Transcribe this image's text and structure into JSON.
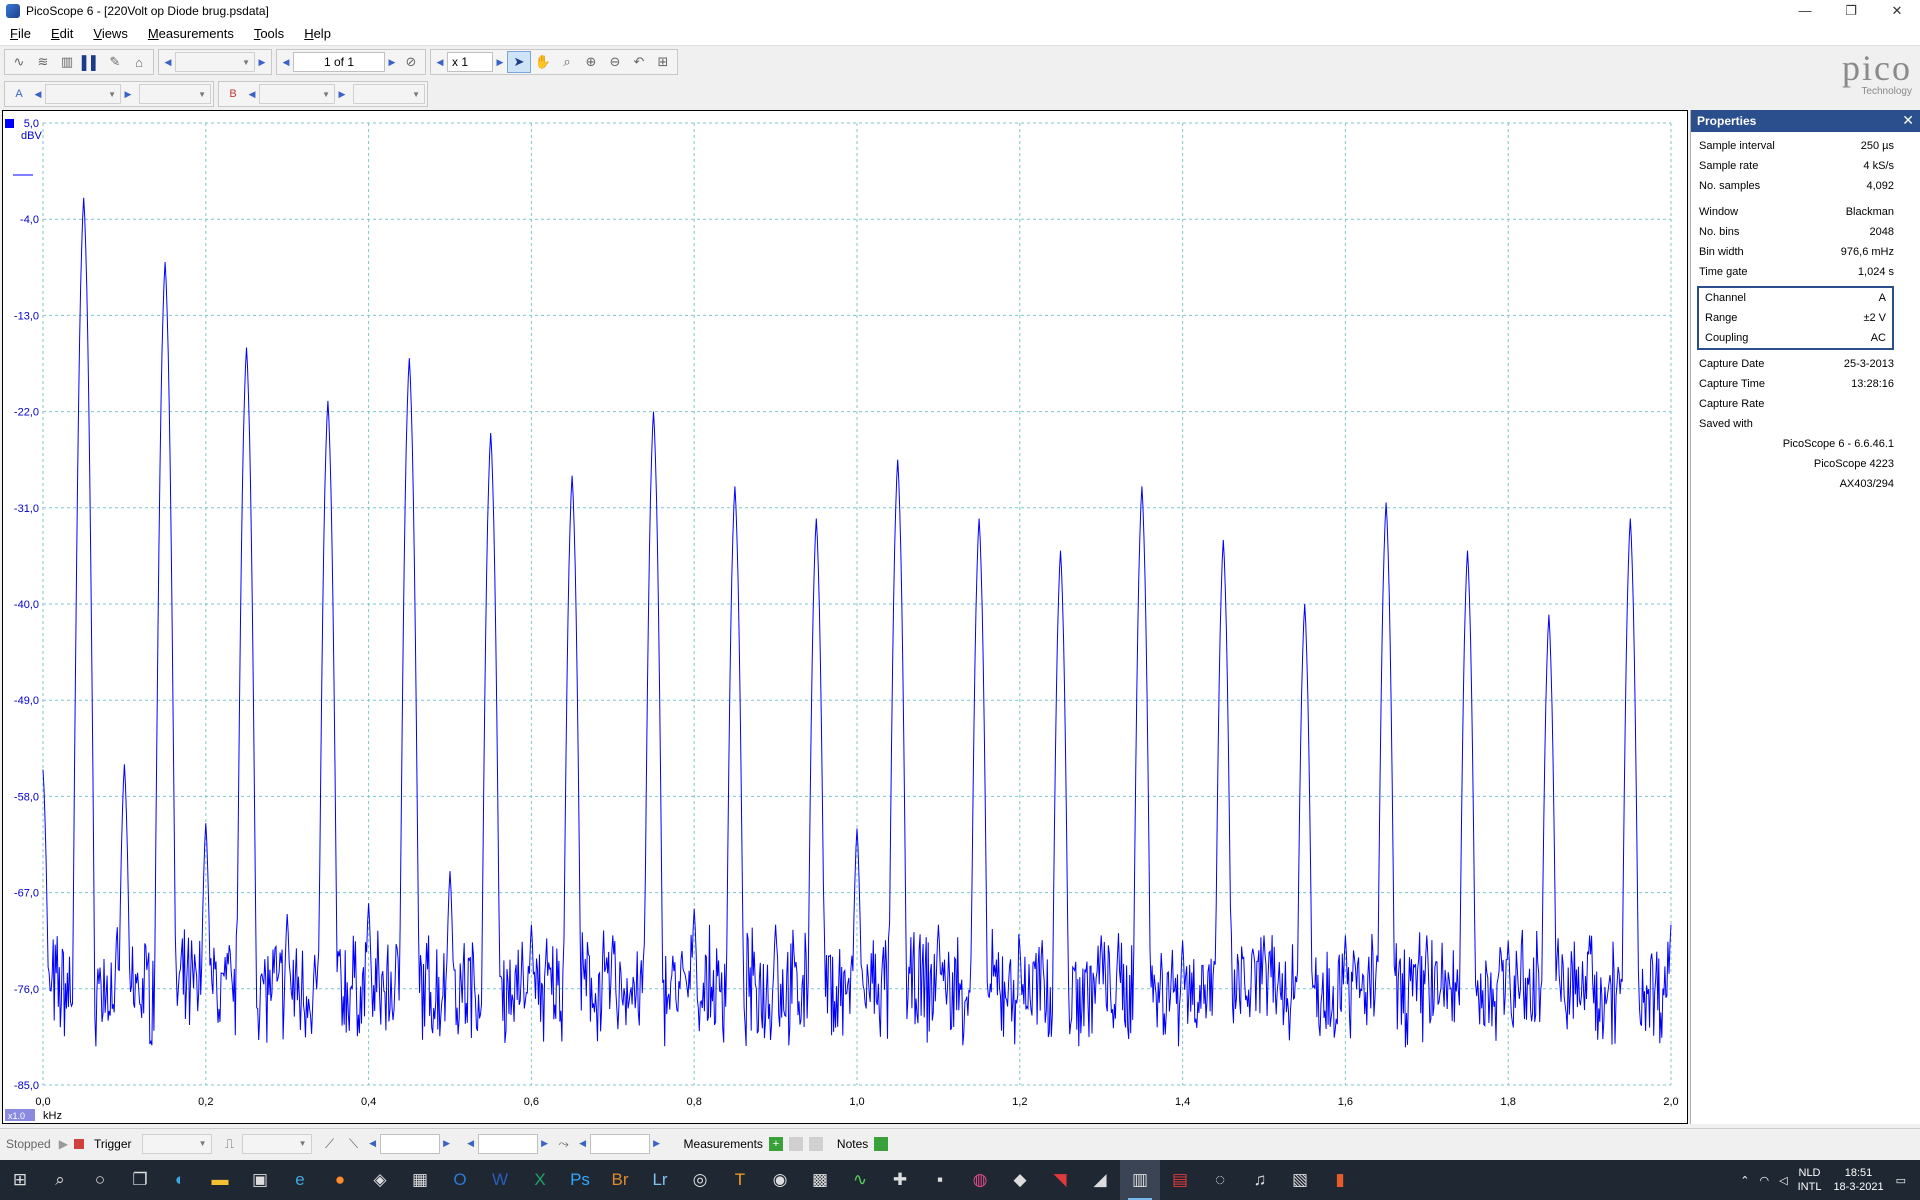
{
  "window": {
    "title": "PicoScope 6 - [220Volt op Diode brug.psdata]",
    "controls": [
      "—",
      "❐",
      "✕"
    ]
  },
  "menu": [
    "File",
    "Edit",
    "Views",
    "Measurements",
    "Tools",
    "Help"
  ],
  "toolbar": {
    "page_indicator": "1 of 1",
    "zoom_factor": "x 1"
  },
  "channels": {
    "a_label": "A",
    "b_label": "B"
  },
  "logo": {
    "brand": "pico",
    "sub": "Technology"
  },
  "plot": {
    "y_unit": "dBV",
    "x_unit": "kHz",
    "x_scale_badge": "x1.0",
    "accent": "#0000ff"
  },
  "chart_data": {
    "type": "line",
    "x_unit": "kHz",
    "y_unit": "dBV",
    "xlim": [
      0.0,
      2.0
    ],
    "ylim": [
      -85.0,
      5.0
    ],
    "x_ticks": [
      "0,0",
      "0,2",
      "0,4",
      "0,6",
      "0,8",
      "1,0",
      "1,2",
      "1,4",
      "1,6",
      "1,8",
      "2,0"
    ],
    "y_ticks": [
      "5,0",
      "-4,0",
      "-13,0",
      "-22,0",
      "-31,0",
      "-40,0",
      "-49,0",
      "-58,0",
      "-67,0",
      "-76,0",
      "-85,0"
    ],
    "grid": true,
    "noise_floor": -76.0,
    "peaks": [
      {
        "x": 0.0,
        "y": -55.5
      },
      {
        "x": 0.05,
        "y": -2.0
      },
      {
        "x": 0.1,
        "y": -55.0
      },
      {
        "x": 0.15,
        "y": -8.0
      },
      {
        "x": 0.2,
        "y": -60.5
      },
      {
        "x": 0.25,
        "y": -16.0
      },
      {
        "x": 0.3,
        "y": -69.0
      },
      {
        "x": 0.35,
        "y": -21.0
      },
      {
        "x": 0.4,
        "y": -68.0
      },
      {
        "x": 0.45,
        "y": -17.0
      },
      {
        "x": 0.5,
        "y": -65.0
      },
      {
        "x": 0.55,
        "y": -24.0
      },
      {
        "x": 0.6,
        "y": -70.0
      },
      {
        "x": 0.65,
        "y": -28.0
      },
      {
        "x": 0.7,
        "y": -71.0
      },
      {
        "x": 0.75,
        "y": -22.0
      },
      {
        "x": 0.8,
        "y": -68.5
      },
      {
        "x": 0.85,
        "y": -29.0
      },
      {
        "x": 0.9,
        "y": -70.0
      },
      {
        "x": 0.95,
        "y": -32.0
      },
      {
        "x": 1.0,
        "y": -61.0
      },
      {
        "x": 1.05,
        "y": -26.5
      },
      {
        "x": 1.1,
        "y": -70.0
      },
      {
        "x": 1.15,
        "y": -32.0
      },
      {
        "x": 1.2,
        "y": -72.0
      },
      {
        "x": 1.25,
        "y": -35.0
      },
      {
        "x": 1.3,
        "y": -71.0
      },
      {
        "x": 1.35,
        "y": -29.0
      },
      {
        "x": 1.4,
        "y": -71.5
      },
      {
        "x": 1.45,
        "y": -34.0
      },
      {
        "x": 1.5,
        "y": -71.0
      },
      {
        "x": 1.55,
        "y": -40.0
      },
      {
        "x": 1.6,
        "y": -71.0
      },
      {
        "x": 1.65,
        "y": -30.5
      },
      {
        "x": 1.7,
        "y": -71.0
      },
      {
        "x": 1.75,
        "y": -35.0
      },
      {
        "x": 1.8,
        "y": -71.5
      },
      {
        "x": 1.85,
        "y": -41.0
      },
      {
        "x": 1.9,
        "y": -71.0
      },
      {
        "x": 1.95,
        "y": -32.0
      },
      {
        "x": 2.0,
        "y": -70.0
      }
    ]
  },
  "properties": {
    "title": "Properties",
    "rows1": [
      {
        "k": "Sample interval",
        "v": "250 µs"
      },
      {
        "k": "Sample rate",
        "v": "4 kS/s"
      },
      {
        "k": "No. samples",
        "v": "4,092"
      }
    ],
    "rows2": [
      {
        "k": "Window",
        "v": "Blackman"
      },
      {
        "k": "No. bins",
        "v": "2048"
      },
      {
        "k": "Bin width",
        "v": "976,6 mHz"
      },
      {
        "k": "Time gate",
        "v": "1,024 s"
      }
    ],
    "channel_box": [
      {
        "k": "Channel",
        "v": "A"
      },
      {
        "k": "Range",
        "v": "±2 V"
      },
      {
        "k": "Coupling",
        "v": "AC"
      }
    ],
    "rows3": [
      {
        "k": "Capture Date",
        "v": "25-3-2013"
      },
      {
        "k": "Capture Time",
        "v": "13:28:16"
      },
      {
        "k": "Capture Rate",
        "v": ""
      },
      {
        "k": "Saved with",
        "v": ""
      }
    ],
    "saved_lines": [
      "PicoScope 6 - 6.6.46.1",
      "PicoScope 4223",
      "AX403/294"
    ]
  },
  "status": {
    "state": "Stopped",
    "trigger_label": "Trigger",
    "measurements_label": "Measurements",
    "notes_label": "Notes"
  },
  "taskbar": {
    "lang": "NLD",
    "layout": "INTL",
    "time": "18:51",
    "date": "18-3-2021"
  }
}
